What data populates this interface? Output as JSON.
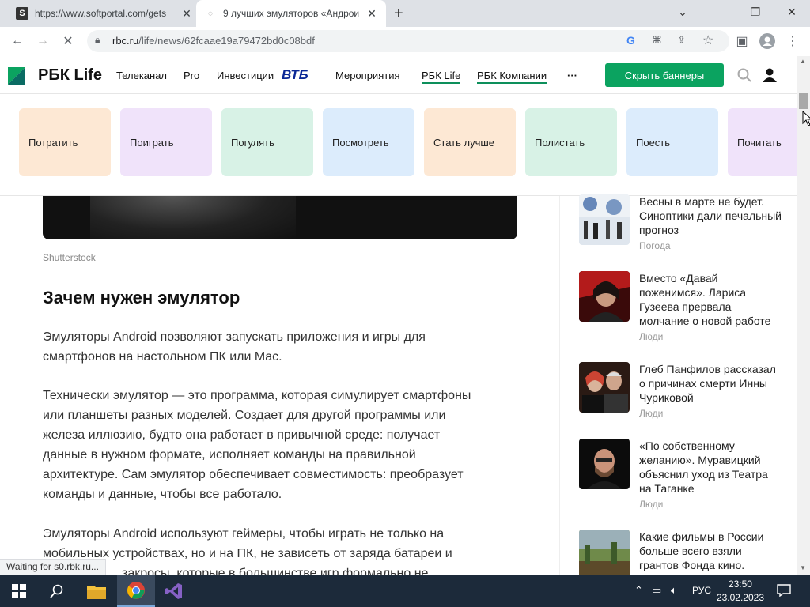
{
  "browser": {
    "tabs": [
      {
        "title": "https://www.softportal.com/gets",
        "favicon": "S"
      },
      {
        "title": "9 лучших эмуляторов «Андрои"
      }
    ],
    "new_tab": "+",
    "url_host": "rbc.ru",
    "url_path": "/life/news/62fcaae19a79472bd0c08bdf"
  },
  "site": {
    "logo": "РБК Life",
    "nav": [
      "Телеканал",
      "Pro",
      "Инвестиции",
      "ВТБ",
      "Мероприятия",
      "РБК Life",
      "РБК Компании",
      "···"
    ],
    "hide_banners": "Скрыть баннеры"
  },
  "categories": [
    {
      "label": "Потратить",
      "color": "#fde8d4"
    },
    {
      "label": "Поиграть",
      "color": "#f0e3fa"
    },
    {
      "label": "Погулять",
      "color": "#d8f2e6"
    },
    {
      "label": "Посмотреть",
      "color": "#dcecfc"
    },
    {
      "label": "Стать лучше",
      "color": "#fde8d4"
    },
    {
      "label": "Полистать",
      "color": "#d8f2e6"
    },
    {
      "label": "Поесть",
      "color": "#dcecfc"
    },
    {
      "label": "Почитать",
      "color": "#f0e3fa"
    }
  ],
  "article": {
    "caption": "Shutterstock",
    "heading": "Зачем нужен эмулятор",
    "p1_lines": [
      "Эмуляторы Android позволяют запускать приложения и игры для",
      "смартфонов на настольном ПК или Mac."
    ],
    "p2_lines": [
      "Технически эмулятор — это программа, которая симулирует смартфоны",
      "или планшеты разных моделей. Создает для другой программы или",
      "железа иллюзию, будто она работает в привычной среде: получает",
      "данные в нужном формате, исполняет команды на правильной",
      "архитектуре. Сам эмулятор обеспечивает совместимость: преобразует",
      "команды и данные, чтобы все работало."
    ],
    "p3_lines": [
      "Эмуляторы Android используют геймеры, чтобы играть не только на",
      "мобильных устройствах, но и на ПК, не зависеть от заряда батареи и",
      "закросы, которые в большинстве игр формально не"
    ]
  },
  "sidebar": [
    {
      "title": "Весны в марте не будет. Синоптики дали печальный прогноз",
      "tag": "Погода"
    },
    {
      "title": "Вместо «Давай поженимся». Лариса Гузеева прервала молчание о новой работе",
      "tag": "Люди"
    },
    {
      "title": "Глеб Панфилов рассказал о причинах смерти Инны Чуриковой",
      "tag": "Люди"
    },
    {
      "title": "«По собственному желанию». Муравицкий объяснил уход из Театра на Таганке",
      "tag": "Люди"
    },
    {
      "title": "Какие фильмы в России больше всего взяли грантов Фонда кино.",
      "tag": ""
    }
  ],
  "status": "Waiting for s0.rbk.ru...",
  "taskbar": {
    "lang": "РУС",
    "time": "23:50",
    "date": "23.02.2023"
  }
}
